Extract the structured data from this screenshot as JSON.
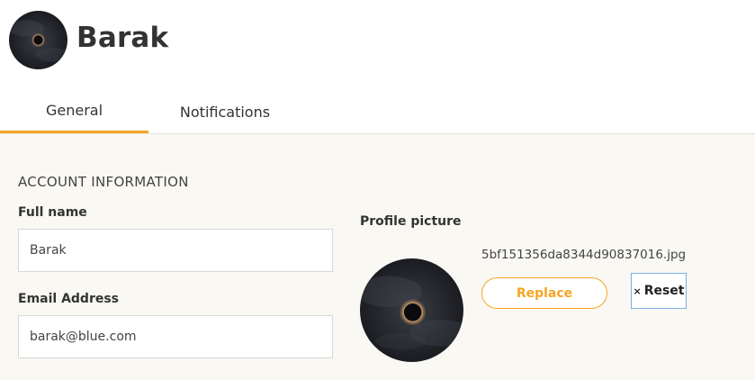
{
  "header": {
    "user_name": "Barak",
    "avatar_icon": "eclipse-avatar-icon"
  },
  "tabs": [
    {
      "label": "General",
      "active": true
    },
    {
      "label": "Notifications",
      "active": false
    }
  ],
  "account": {
    "section_title": "ACCOUNT INFORMATION",
    "full_name_label": "Full name",
    "full_name_value": "Barak",
    "email_label": "Email Address",
    "email_value": "barak@blue.com"
  },
  "profile_picture": {
    "label": "Profile picture",
    "file_name": "5bf151356da8344d90837016.jpg",
    "replace_label": "Replace",
    "reset_icon": "×",
    "reset_label": "Reset"
  },
  "colors": {
    "accent": "#f5a623",
    "content_background": "#faf8f3",
    "focus_border": "#7aaee6"
  }
}
